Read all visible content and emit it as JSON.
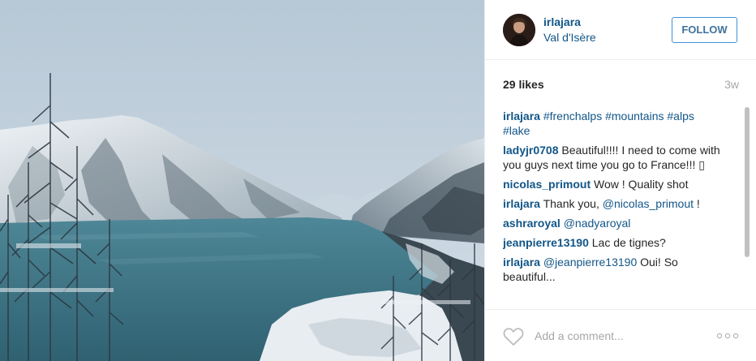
{
  "photo": {
    "alt": "Snowy mountains around a turquoise alpine lake",
    "colors": {
      "sky": "#c2d1dd",
      "lake": "#3f7384",
      "snow": "#e6ecf1",
      "rock": "#3a4852"
    }
  },
  "header": {
    "username": "irlajara",
    "location": "Val d'Isère",
    "follow_label": "FOLLOW"
  },
  "stats": {
    "likes": "29 likes",
    "age": "3w"
  },
  "comments": [
    {
      "user": "irlajara",
      "segments": [
        {
          "text": "#frenchalps",
          "link": true
        },
        {
          "text": " ",
          "link": false
        },
        {
          "text": "#mountains",
          "link": true
        },
        {
          "text": " ",
          "link": false
        },
        {
          "text": "#alps",
          "link": true
        },
        {
          "text": " ",
          "link": false
        },
        {
          "text": "#lake",
          "link": true
        }
      ]
    },
    {
      "user": "ladyjr0708",
      "segments": [
        {
          "text": "Beautiful!!!! I need to come with you guys next time you go to France!!! ",
          "link": false
        },
        {
          "text": "▯",
          "link": false
        }
      ]
    },
    {
      "user": "nicolas_primout",
      "segments": [
        {
          "text": "Wow ! Quality shot",
          "link": false
        }
      ]
    },
    {
      "user": "irlajara",
      "segments": [
        {
          "text": "Thank you, ",
          "link": false
        },
        {
          "text": "@nicolas_primout",
          "link": true
        },
        {
          "text": " !",
          "link": false
        }
      ]
    },
    {
      "user": "ashraroyal",
      "segments": [
        {
          "text": "@nadyaroyal",
          "link": true
        }
      ]
    },
    {
      "user": "jeanpierre13190",
      "segments": [
        {
          "text": "Lac de tignes?",
          "link": false
        }
      ]
    },
    {
      "user": "irlajara",
      "segments": [
        {
          "text": "@jeanpierre13190",
          "link": true
        },
        {
          "text": " Oui! So beautiful...",
          "link": false
        }
      ]
    }
  ],
  "footer": {
    "comment_placeholder": "Add a comment...",
    "like_icon": "heart-outline-icon",
    "more_icon": "more-options-icon"
  },
  "colors": {
    "link": "#125688",
    "follow_border": "#4090db",
    "follow_text": "#3f729b",
    "muted": "#a5a7aa"
  }
}
